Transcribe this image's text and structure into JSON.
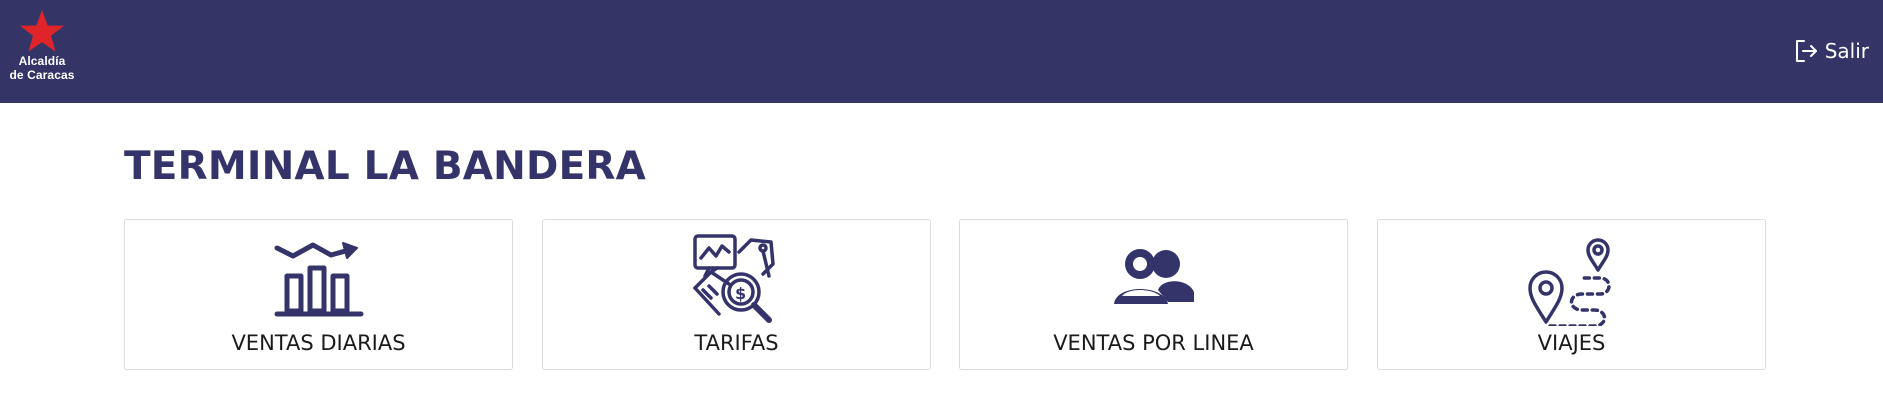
{
  "header": {
    "logo": {
      "icon": "star-icon",
      "line1": "Alcaldía",
      "line2": "de Caracas",
      "star_color": "#e0252a"
    },
    "logout": {
      "label": "Salir",
      "icon": "logout-icon"
    },
    "background": "#343466"
  },
  "main": {
    "title": "TERMINAL LA BANDERA",
    "cards": [
      {
        "label": "VENTAS DIARIAS",
        "icon": "bar-chart-trend-icon"
      },
      {
        "label": "TARIFAS",
        "icon": "pricing-analysis-icon"
      },
      {
        "label": "VENTAS POR LINEA",
        "icon": "users-icon"
      },
      {
        "label": "VIAJES",
        "icon": "route-pins-icon"
      }
    ]
  },
  "colors": {
    "primary": "#34346a",
    "card_border": "#dcdcdc",
    "text": "#1a1a1a"
  }
}
